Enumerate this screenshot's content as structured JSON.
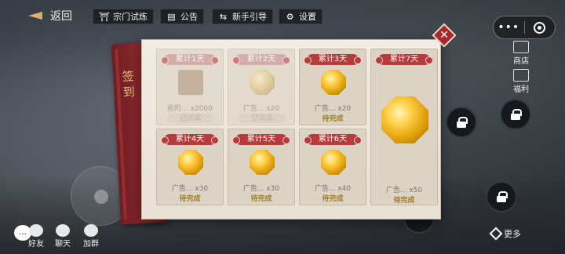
{
  "topbar": {
    "back_label": "返回",
    "buttons": [
      {
        "label": "宗门试炼",
        "icon": "temple-icon"
      },
      {
        "label": "公告",
        "icon": "notice-icon"
      },
      {
        "label": "新手引导",
        "icon": "signpost-icon"
      },
      {
        "label": "设置",
        "icon": "gear-icon"
      }
    ]
  },
  "capsule": {
    "menu_dots": "•••"
  },
  "side": {
    "shop_label": "商店",
    "welfare_label": "福利"
  },
  "signin": {
    "title": "签到",
    "close_symbol": "✕",
    "days": [
      {
        "tag": "累计1天",
        "label": "雨的... x2000",
        "status": "已完成",
        "done": true,
        "item": "scroll"
      },
      {
        "tag": "累计2天",
        "label": "广告... x20",
        "status": "已完成",
        "done": true,
        "item": "gem"
      },
      {
        "tag": "累计3天",
        "label": "广告... x20",
        "status": "待完成",
        "done": false,
        "item": "gem"
      },
      {
        "tag": "累计4天",
        "label": "广告... x30",
        "status": "待完成",
        "done": false,
        "item": "gem"
      },
      {
        "tag": "累计5天",
        "label": "广告... x30",
        "status": "待完成",
        "done": false,
        "item": "gem"
      },
      {
        "tag": "累计6天",
        "label": "广告... x40",
        "status": "待完成",
        "done": false,
        "item": "gem"
      },
      {
        "tag": "累计7天",
        "label": "广告... x50",
        "status": "待完成",
        "done": false,
        "item": "gem"
      }
    ]
  },
  "bottom": {
    "chat_icon": "…",
    "friends_label": "好友",
    "chat_label": "聊天",
    "add_label": "加群",
    "more_label": "更多"
  }
}
